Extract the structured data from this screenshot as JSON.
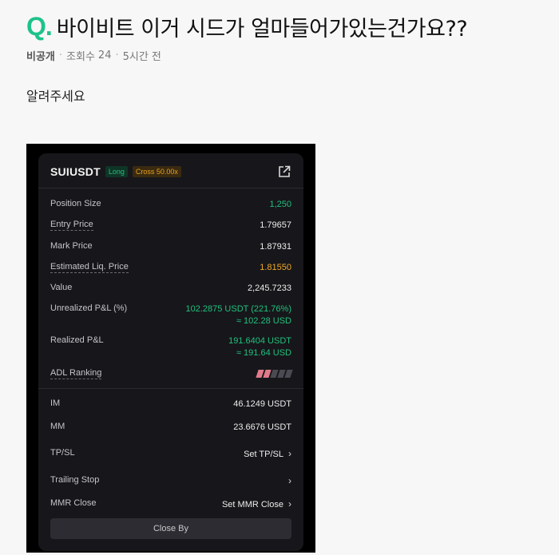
{
  "question": {
    "mark": "Q.",
    "title": "바이비트 이거 시드가 얼마들어가있는건가요??"
  },
  "meta": {
    "author": "비공개",
    "views_label": "조회수",
    "views": "24",
    "time": "5시간 전"
  },
  "body": "알려주세요",
  "position": {
    "symbol": "SUIUSDT",
    "side_badge": "Long",
    "margin_badge": "Cross 50.00x",
    "rows": {
      "position_size": {
        "label": "Position Size",
        "value": "1,250"
      },
      "entry_price": {
        "label": "Entry Price",
        "value": "1.79657"
      },
      "mark_price": {
        "label": "Mark Price",
        "value": "1.87931"
      },
      "liq_price": {
        "label": "Estimated Liq. Price",
        "value": "1.81550"
      },
      "value": {
        "label": "Value",
        "value": "2,245.7233"
      },
      "unrealized": {
        "label": "Unrealized P&L (%)",
        "value": "102.2875 USDT (221.76%)",
        "sub": "≈ 102.28 USD"
      },
      "realized": {
        "label": "Realized P&L",
        "value": "191.6404 USDT",
        "sub": "≈ 191.64 USD"
      },
      "adl": {
        "label": "ADL Ranking",
        "level": 2,
        "max": 5
      },
      "im": {
        "label": "IM",
        "value": "46.1249 USDT"
      },
      "mm": {
        "label": "MM",
        "value": "23.6676 USDT"
      },
      "tpsl": {
        "label": "TP/SL",
        "value": "Set TP/SL"
      },
      "trailing": {
        "label": "Trailing Stop"
      },
      "mmr": {
        "label": "MMR Close",
        "value": "Set MMR Close"
      }
    },
    "close_button": "Close By"
  },
  "colors": {
    "accent": "#1ec28b",
    "green": "#20c07d",
    "orange": "#f0a724",
    "adl_on": "#e07a8a"
  }
}
